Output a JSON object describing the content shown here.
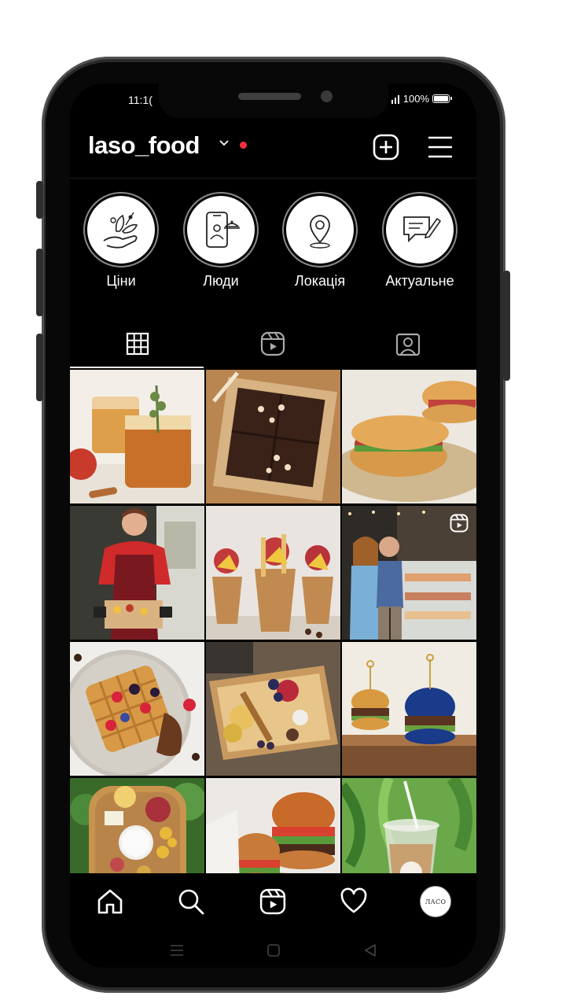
{
  "status_bar": {
    "time": "11:1(",
    "battery_percent": "100%"
  },
  "profile": {
    "username": "laso_food"
  },
  "highlights": [
    {
      "label": "Ціни",
      "icon": "hand-leaves-icon"
    },
    {
      "label": "Люди",
      "icon": "phone-delivery-icon"
    },
    {
      "label": "Локація",
      "icon": "location-pin-icon"
    },
    {
      "label": "Актуальне",
      "icon": "chat-pencil-icon"
    }
  ],
  "tabs": [
    {
      "name": "posts-grid",
      "icon": "grid-icon",
      "active": true
    },
    {
      "name": "reels",
      "icon": "reels-icon",
      "active": false
    },
    {
      "name": "tagged",
      "icon": "tagged-user-icon",
      "active": false
    }
  ],
  "posts": [
    {
      "subject": "tea-with-thyme",
      "reel": false
    },
    {
      "subject": "brownies-box",
      "reel": false
    },
    {
      "subject": "croissant-sandwich",
      "reel": false
    },
    {
      "subject": "woman-holding-box",
      "reel": false
    },
    {
      "subject": "fruit-cups",
      "reel": false
    },
    {
      "subject": "couple-in-cafe",
      "reel": true
    },
    {
      "subject": "waffles-berries",
      "reel": false
    },
    {
      "subject": "snack-box",
      "reel": false
    },
    {
      "subject": "burgers-on-wood",
      "reel": false
    },
    {
      "subject": "charcuterie-box",
      "reel": false
    },
    {
      "subject": "burgers-plate",
      "reel": false
    },
    {
      "subject": "iced-drink",
      "reel": false
    }
  ],
  "bottom_nav": {
    "avatar_text": "ЛАСО"
  },
  "colors": {
    "background": "#000000",
    "accent_dot": "#ff3040",
    "text": "#ffffff"
  }
}
